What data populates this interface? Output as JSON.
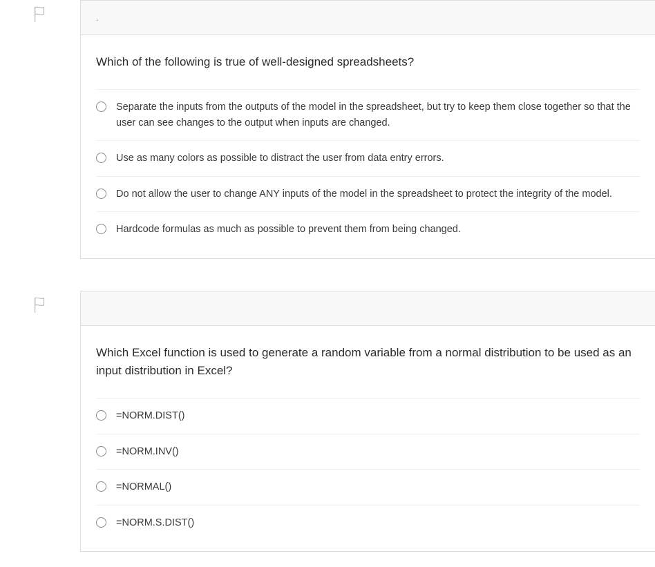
{
  "questions": [
    {
      "header": ".",
      "prompt": "Which of the following is true of well-designed spreadsheets?",
      "options": [
        "Separate the inputs from the outputs of the model in the spreadsheet, but try to keep them close together so that the user can see changes to the output when inputs are changed.",
        "Use as many colors as possible to distract the user from data entry errors.",
        "Do not allow the user to change ANY inputs of the model in the spreadsheet to protect the integrity of the model.",
        "Hardcode formulas as much as possible to prevent them from being changed."
      ]
    },
    {
      "header": "",
      "prompt": "Which Excel function is used to generate a random variable from a normal distribution to be used as an input distribution in Excel?",
      "options": [
        "=NORM.DIST()",
        "=NORM.INV()",
        "=NORMAL()",
        "=NORM.S.DIST()"
      ]
    }
  ]
}
